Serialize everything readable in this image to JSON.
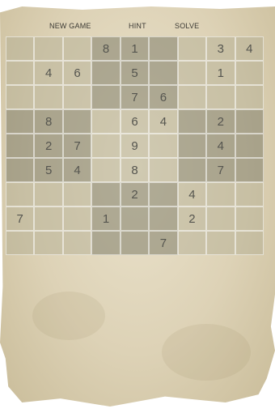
{
  "menu": {
    "new_game": "NEW GAME",
    "hint": "HINT",
    "solve": "SOLVE"
  },
  "board": [
    [
      "",
      "",
      "",
      "8",
      "1",
      "",
      "",
      "3",
      "4"
    ],
    [
      "",
      "4",
      "6",
      "",
      "5",
      "",
      "",
      "1",
      ""
    ],
    [
      "",
      "",
      "",
      "",
      "7",
      "6",
      "",
      "",
      ""
    ],
    [
      "",
      "8",
      "",
      "",
      "6",
      "4",
      "",
      "2",
      ""
    ],
    [
      "",
      "2",
      "7",
      "",
      "9",
      "",
      "",
      "4",
      ""
    ],
    [
      "",
      "5",
      "4",
      "",
      "8",
      "",
      "",
      "7",
      ""
    ],
    [
      "",
      "",
      "",
      "",
      "2",
      "",
      "4",
      "",
      ""
    ],
    [
      "7",
      "",
      "",
      "1",
      "",
      "",
      "2",
      "",
      ""
    ],
    [
      "",
      "",
      "",
      "",
      "",
      "7",
      "",
      "",
      ""
    ]
  ]
}
